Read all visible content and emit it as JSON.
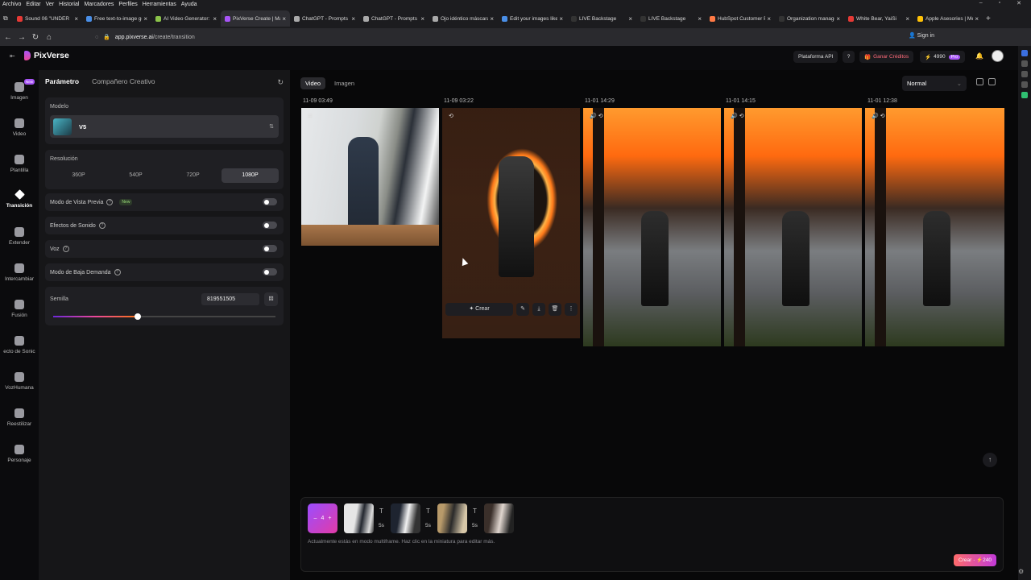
{
  "browser": {
    "menu": [
      "Archivo",
      "Editar",
      "Ver",
      "Historial",
      "Marcadores",
      "Perfiles",
      "Herramientas",
      "Ayuda"
    ],
    "tabs": [
      {
        "title": "Sound 06 \"UNDER",
        "color": "#e53935"
      },
      {
        "title": "Free text-to-image ge",
        "color": "#4a8fe7"
      },
      {
        "title": "AI Video Generator: C",
        "color": "#8bc34a"
      },
      {
        "title": "PixVerse Create | Mak",
        "color": "#a855f7"
      },
      {
        "title": "ChatGPT - Prompts Ge",
        "color": "#aaaaaa"
      },
      {
        "title": "ChatGPT - Prompts Ge",
        "color": "#aaaaaa"
      },
      {
        "title": "Ojo idéntico máscara",
        "color": "#aaaaaa"
      },
      {
        "title": "Edit your images like",
        "color": "#4a8fe7"
      },
      {
        "title": "LIVE Backstage",
        "color": "#333333"
      },
      {
        "title": "LIVE Backstage",
        "color": "#333333"
      },
      {
        "title": "HubSpot Customer Pl",
        "color": "#ff7a45"
      },
      {
        "title": "Organization managem",
        "color": "#333333"
      },
      {
        "title": "White Bear, YaiSi",
        "color": "#e53935"
      },
      {
        "title": "Apple Asesories | Me",
        "color": "#ffc107"
      }
    ],
    "url_host": "app.pixverse.ai",
    "url_path": "/create/transition",
    "sign_in": "Sign in"
  },
  "header": {
    "brand": "PixVerse",
    "api_label": "Plataforma API",
    "earn_label": "Ganar Créditos",
    "credits": "4990",
    "plan": "Pro"
  },
  "nav": {
    "new_badge": "New",
    "items": [
      {
        "label": "Imagen"
      },
      {
        "label": "Video"
      },
      {
        "label": "Plantilla"
      },
      {
        "label": "Transición"
      },
      {
        "label": "Extender"
      },
      {
        "label": "Intercambiar"
      },
      {
        "label": "Fusión"
      },
      {
        "label": "ecto de Sonic"
      },
      {
        "label": "VozHumana"
      },
      {
        "label": "Reestilizar"
      },
      {
        "label": "Personaje"
      }
    ]
  },
  "panel": {
    "tab_params": "Parámetro",
    "tab_creative": "Compañero Creativo",
    "model_label": "Modelo",
    "model_name": "V5",
    "resolution_label": "Resolución",
    "resolutions": [
      "360P",
      "540P",
      "720P",
      "1080P"
    ],
    "preview_mode": "Modo de Vista Previa",
    "preview_new": "New",
    "sound_effects": "Efectos de Sonido",
    "voice": "Voz",
    "low_demand": "Modo de Baja Demanda",
    "seed_label": "Semilla",
    "seed_value": "819551505",
    "seed_level": 0.38
  },
  "main": {
    "tab_video": "Video",
    "tab_image": "Imagen",
    "view_select": "Normal",
    "timestamps": [
      "11-09 03:49",
      "11-09 03:22",
      "11-01 14:29",
      "11-01 14:15",
      "11-01 12:38"
    ],
    "create_label": "Crear"
  },
  "composer": {
    "stack_count": "4",
    "durations": [
      "5s",
      "5s",
      "5s"
    ],
    "hint": "Actualmente estás en modo multiframe. Haz clic en la miniatura para editar más.",
    "submit_label": "Crear",
    "submit_cost": "240"
  }
}
